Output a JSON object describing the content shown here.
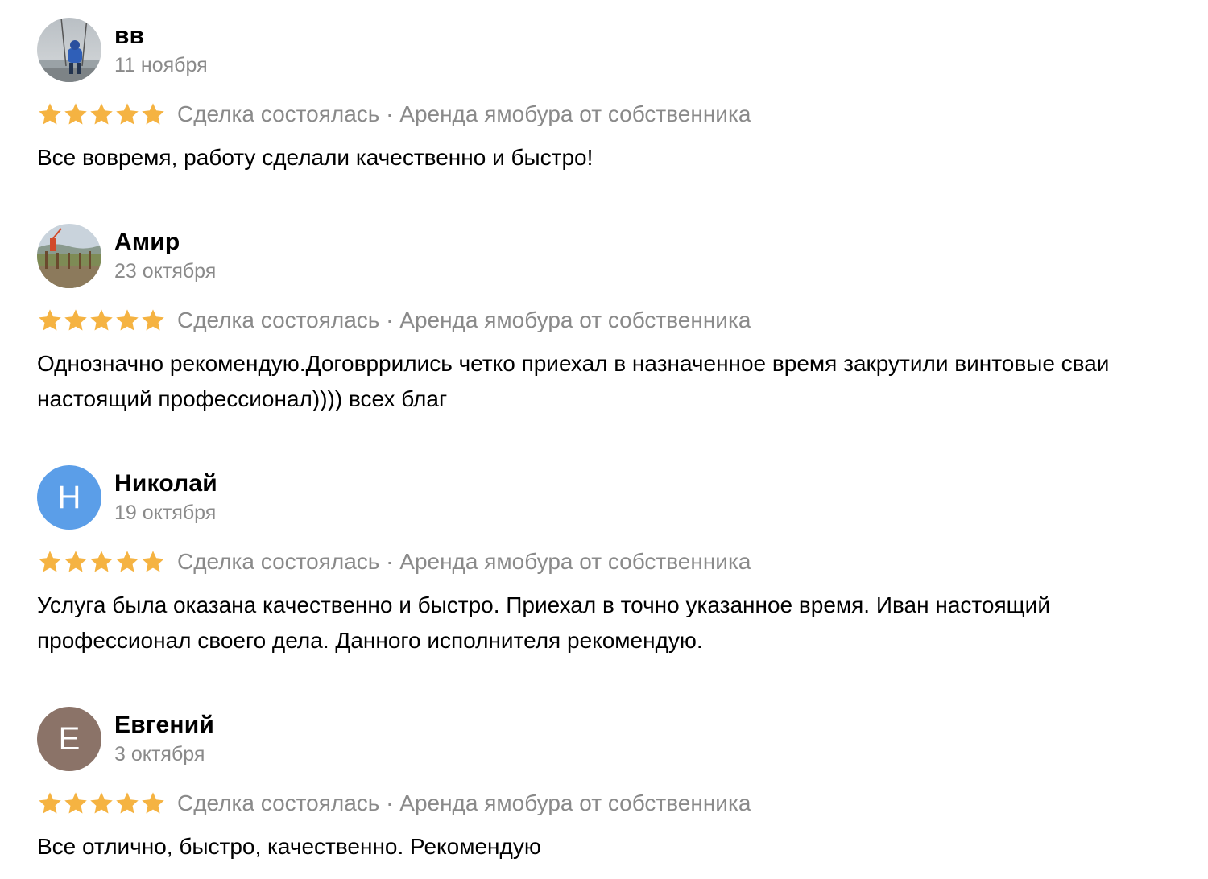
{
  "colors": {
    "star": "#f5b342",
    "muted_text": "#8a8a8a",
    "avatar_blue": "#5b9ee8",
    "avatar_brown": "#8b7368"
  },
  "reviews": [
    {
      "name": "вв",
      "date": "11 ноября",
      "avatar": {
        "type": "photo",
        "icon": "photo-avatar-swing"
      },
      "rating": 5,
      "meta": "Сделка состоялась · Аренда ямобура от собственника",
      "text": "Все вовремя, работу сделали качественно и быстро!"
    },
    {
      "name": "Амир",
      "date": "23 октября",
      "avatar": {
        "type": "photo",
        "icon": "photo-avatar-field"
      },
      "rating": 5,
      "meta": "Сделка состоялась · Аренда ямобура от собственника",
      "text": "Однозначно рекомендую.Договррились четко приехал в назначенное время закрутили винтовые сваи настоящий профессионал)))) всех благ"
    },
    {
      "name": "Николай",
      "date": "19 октября",
      "avatar": {
        "type": "letter",
        "letter": "Н",
        "color": "#5b9ee8"
      },
      "rating": 5,
      "meta": "Сделка состоялась · Аренда ямобура от собственника",
      "text": "Услуга была оказана качественно и быстро. Приехал в точно указанное время. Иван настоящий профессионал своего дела. Данного исполнителя рекомендую."
    },
    {
      "name": "Евгений",
      "date": "3 октября",
      "avatar": {
        "type": "letter",
        "letter": "Е",
        "color": "#8b7368"
      },
      "rating": 5,
      "meta": "Сделка состоялась · Аренда ямобура от собственника",
      "text": "Все отлично, быстро, качественно. Рекомендую"
    }
  ]
}
